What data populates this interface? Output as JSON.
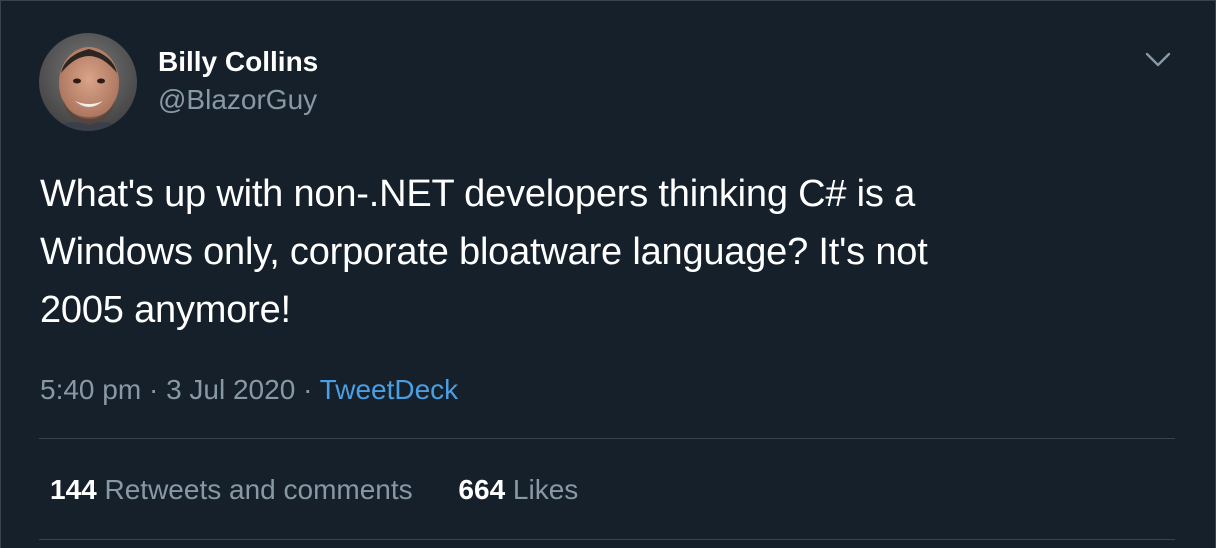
{
  "author": {
    "display_name": "Billy Collins",
    "handle": "@BlazorGuy",
    "avatar_icon": "profile-photo"
  },
  "tweet": {
    "text_lines": [
      "What's up with non-.NET developers thinking C# is a",
      "Windows only, corporate bloatware language? It's not",
      "2005 anymore!"
    ],
    "time": "5:40 pm",
    "date": "3 Jul 2020",
    "separator": "·",
    "source": "TweetDeck"
  },
  "stats": {
    "retweets_count": "144",
    "retweets_label": "Retweets and comments",
    "likes_count": "664",
    "likes_label": "Likes"
  },
  "menu": {
    "caret_icon": "chevron-down-icon"
  },
  "colors": {
    "background": "#15202b",
    "border": "#38444d",
    "secondary_text": "#8899a6",
    "link": "#4a9fe3"
  }
}
